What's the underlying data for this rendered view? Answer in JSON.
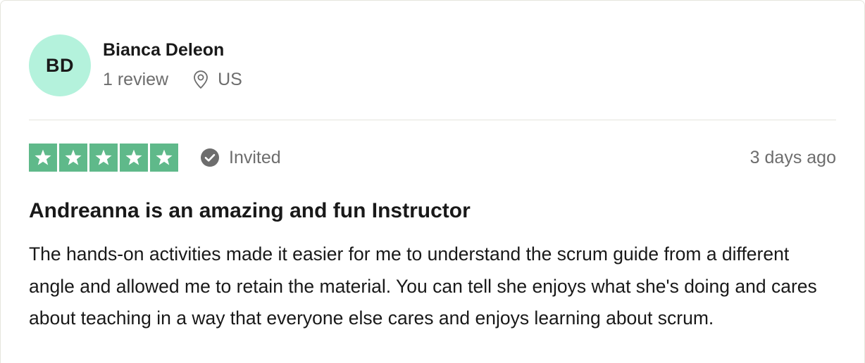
{
  "review": {
    "consumer": {
      "initials": "BD",
      "name": "Bianca Deleon",
      "review_count": "1 review",
      "country": "US",
      "avatar_color": "#b4f2dc"
    },
    "rating": {
      "stars": 5,
      "max_stars": 5,
      "star_color": "#5fb98a"
    },
    "verification_label": "Invited",
    "date": "3 days ago",
    "title": "Andreanna is an amazing and fun Instructor",
    "body": "The hands-on activities made it easier for me to understand the scrum guide from a different angle and allowed me to retain the material. You can tell she enjoys what she's doing and cares about teaching in a way that everyone else cares and enjoys learning about scrum."
  },
  "icons": {
    "location": "location-pin-icon",
    "verified": "check-circle-icon",
    "star": "star-icon"
  }
}
